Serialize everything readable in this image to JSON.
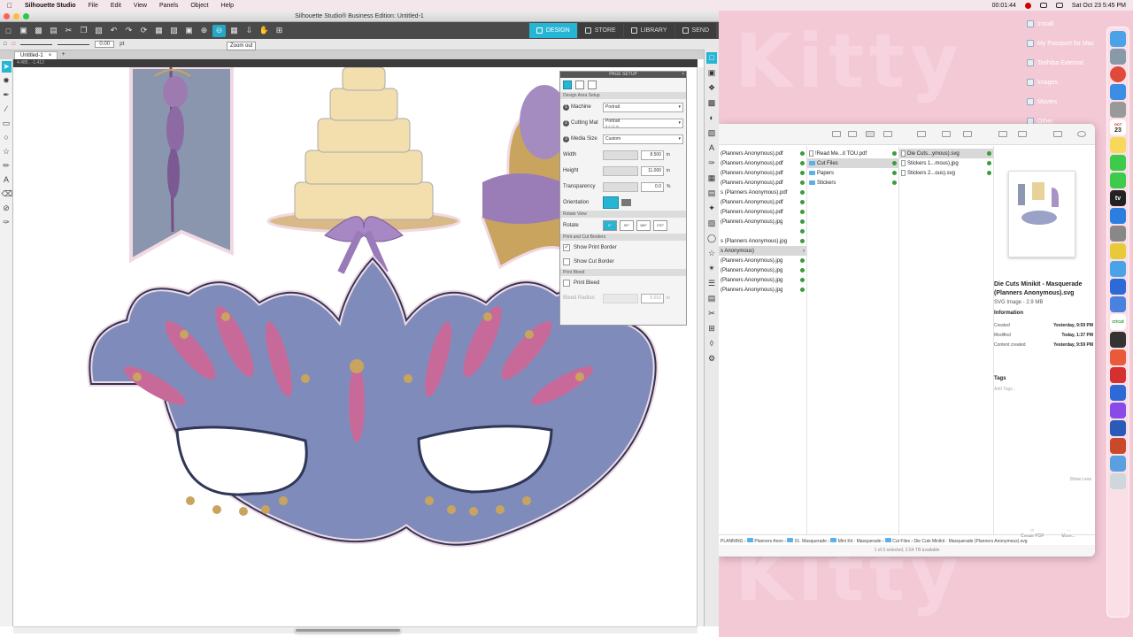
{
  "menubar": {
    "app_name": "Silhouette Studio",
    "menus": [
      "File",
      "Edit",
      "View",
      "Panels",
      "Object",
      "Help"
    ],
    "timer": "00:01:44",
    "clock": "Sat Oct 23  5:45 PM"
  },
  "desktop": {
    "items": [
      "Install",
      "My Passport for Mac",
      "Toshiba External",
      "Images",
      "Movies",
      "Other"
    ]
  },
  "dock": {
    "apps": [
      "finder-icon",
      "launchpad-icon",
      "chrome-icon",
      "mail-icon",
      "contacts-icon",
      "calendar-icon",
      "notes-icon",
      "messages-icon",
      "facetime-icon",
      "tv-icon",
      "app-store-icon",
      "settings-icon",
      "music-icon",
      "onepassword-icon",
      "zoom-icon",
      "keyboard-icon",
      "cricut-icon",
      "camera-icon",
      "paint-icon",
      "silhouette-icon",
      "zoom-icon",
      "messenger-icon",
      "word-icon",
      "powerpoint-icon",
      "downloads-icon",
      "trash-icon"
    ],
    "calendar_day": "23",
    "calendar_month": "OCT",
    "cricut_label": "cricut",
    "tv_label": "tv"
  },
  "silhouette": {
    "window_title": "Silhouette Studio® Business Edition: Untitled-1",
    "tabs": [
      "DESIGN",
      "STORE",
      "LIBRARY",
      "SEND"
    ],
    "active_tab": "DESIGN",
    "tooltip": "Zoom out",
    "line_width": "0.00",
    "line_unit": "pt",
    "doc_tab": "Untitled-1",
    "ruler_readout": "4.485 , -1.412",
    "accent_color": "#26b6d4"
  },
  "page_setup": {
    "title": "PAGE SETUP",
    "design_area_label": "Design Area Setup",
    "machine_label": "Machine",
    "machine_value": "Portrait",
    "cutting_mat_label": "Cutting Mat",
    "cutting_mat_value": "Portrait",
    "cutting_mat_sub": "8 x 12 in",
    "media_size_label": "Media Size",
    "media_size_value": "Custom",
    "width_label": "Width",
    "width_value": "8.500",
    "height_label": "Height",
    "height_value": "11.000",
    "unit_in": "in",
    "transparency_label": "Transparency",
    "transparency_value": "0.0",
    "unit_pct": "%",
    "orientation_label": "Orientation",
    "rotate_view_label": "Rotate View",
    "rotate_label": "Rotate",
    "rotate_options": [
      "0°",
      "90°",
      "180°",
      "270°"
    ],
    "print_cut_label": "Print and Cut Borders",
    "show_print_border": "Show Print Border",
    "show_cut_border": "Show Cut Border",
    "print_bleed_section": "Print Bleed",
    "print_bleed": "Print Bleed",
    "bleed_radius_label": "Bleed Radius",
    "bleed_radius_value": "0.010",
    "show_print_border_checked": true
  },
  "finder": {
    "col1": [
      "(Planners Anonymous).pdf",
      "(Planners Anonymous).pdf",
      "(Planners Anonymous).pdf",
      "(Planners Anonymous).pdf",
      "s (Planners Anonymous).pdf",
      "(Planners Anonymous).pdf",
      "(Planners Anonymous).pdf",
      "(Planners Anonymous).jpg",
      "",
      "s (Planners Anonymous).jpg",
      "s Anonymous)",
      "(Planners Anonymous).jpg",
      "(Planners Anonymous).jpg",
      "(Planners Anonymous).jpg",
      "(Planners Anonymous).jpg"
    ],
    "col2": [
      "!Read Me...it TOU.pdf",
      "Cut Files",
      "Papers",
      "Stickers"
    ],
    "col3": [
      "Die Cuts...ymous).svg",
      "Stickers 1...mous).jpg",
      "Stickers 2...ous).svg"
    ],
    "preview_name": "Die Cuts Minikit - Masquerade (Planners Anonymous).svg",
    "preview_type": "SVG Image - 2.9 MB",
    "information_label": "Information",
    "show_less": "Show Less",
    "info": [
      {
        "k": "Created",
        "v": "Yesterday, 9:59 PM"
      },
      {
        "k": "Modified",
        "v": "Today, 1:37 PM"
      },
      {
        "k": "Content created",
        "v": "Yesterday, 9:59 PM"
      }
    ],
    "tags_label": "Tags",
    "add_tags": "Add Tags...",
    "create_pdf": "Create PDF",
    "more": "More...",
    "path": [
      "PLANNING",
      "Planners Anon",
      "01. Masquerade",
      "Mini Kit - Masquerade",
      "Cut Files",
      "Die Cuts Minikit - Masquerade (Planners Anonymous).svg"
    ],
    "status": "1 of 3 selected, 2.54 TB available"
  }
}
